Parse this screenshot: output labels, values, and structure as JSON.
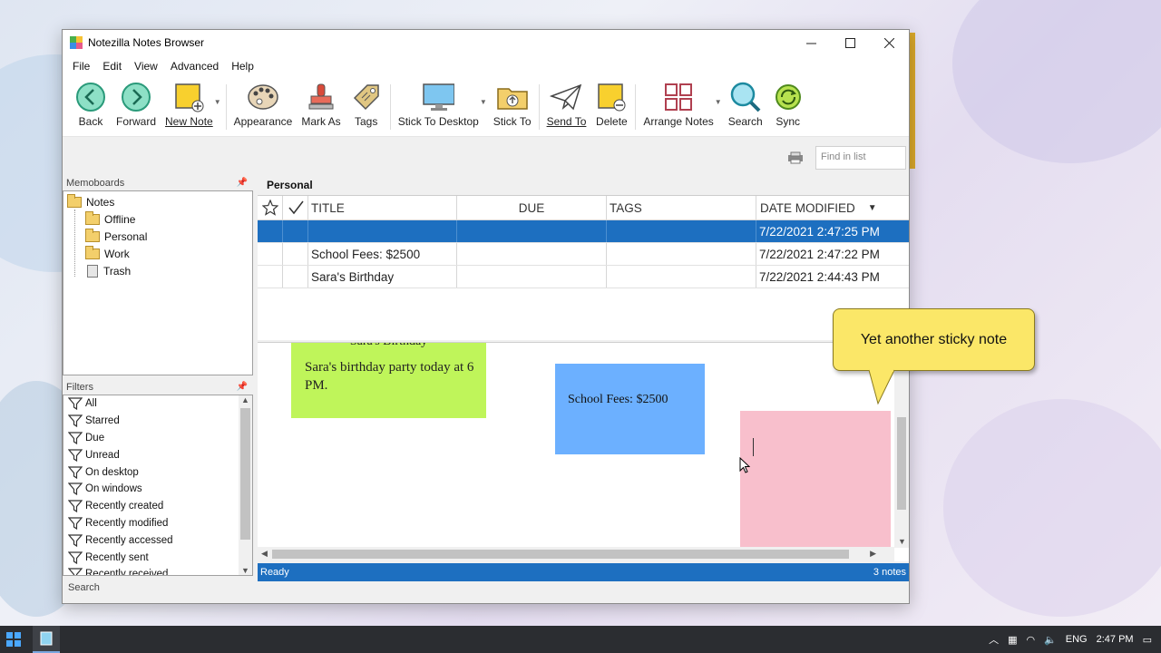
{
  "window": {
    "title": "Notezilla Notes Browser"
  },
  "menu": [
    "File",
    "Edit",
    "View",
    "Advanced",
    "Help"
  ],
  "toolbar": {
    "back": "Back",
    "forward": "Forward",
    "new_note": "New Note",
    "appearance": "Appearance",
    "mark_as": "Mark As",
    "tags": "Tags",
    "stick_to_desktop": "Stick To Desktop",
    "stick_to": "Stick To",
    "send_to": "Send To",
    "delete": "Delete",
    "arrange_notes": "Arrange Notes",
    "search": "Search",
    "sync": "Sync"
  },
  "find": {
    "placeholder": "Find in list"
  },
  "memoboards": {
    "header": "Memoboards",
    "items": [
      {
        "label": "Notes",
        "icon": "folder-icon"
      },
      {
        "label": "Offline",
        "icon": "folder-icon"
      },
      {
        "label": "Personal",
        "icon": "folder-icon"
      },
      {
        "label": "Work",
        "icon": "folder-icon"
      },
      {
        "label": "Trash",
        "icon": "trash-icon"
      }
    ]
  },
  "filters": {
    "header": "Filters",
    "items": [
      "All",
      "Starred",
      "Due",
      "Unread",
      "On desktop",
      "On windows",
      "Recently created",
      "Recently modified",
      "Recently accessed",
      "Recently sent",
      "Recently received"
    ]
  },
  "search_tab": "Search",
  "current_board": "Personal",
  "table": {
    "headers": {
      "title": "TITLE",
      "due": "DUE",
      "tags": "TAGS",
      "date_modified": "DATE MODIFIED"
    },
    "rows": [
      {
        "title": "",
        "due": "",
        "tags": "",
        "date": "7/22/2021 2:47:25 PM",
        "selected": true
      },
      {
        "title": "School Fees: $2500",
        "due": "",
        "tags": "",
        "date": "7/22/2021 2:47:22 PM"
      },
      {
        "title": "Sara's Birthday",
        "due": "",
        "tags": "",
        "date": "7/22/2021 2:44:43 PM"
      }
    ]
  },
  "notes": {
    "green": {
      "title": "Sara's Birthday",
      "body": "Sara's birthday party today at 6 PM.",
      "color": "#bff55a"
    },
    "blue": {
      "body": "School Fees: $2500",
      "color": "#6cb0ff"
    },
    "pink": {
      "body": "",
      "color": "#f8bfcc"
    }
  },
  "status": {
    "text": "Ready",
    "count": "3 notes"
  },
  "callout": "Yet another sticky note",
  "taskbar": {
    "lang": "ENG",
    "time": "2:47 PM"
  },
  "colors": {
    "accent": "#1d6fc0",
    "callout": "#fbe768"
  }
}
